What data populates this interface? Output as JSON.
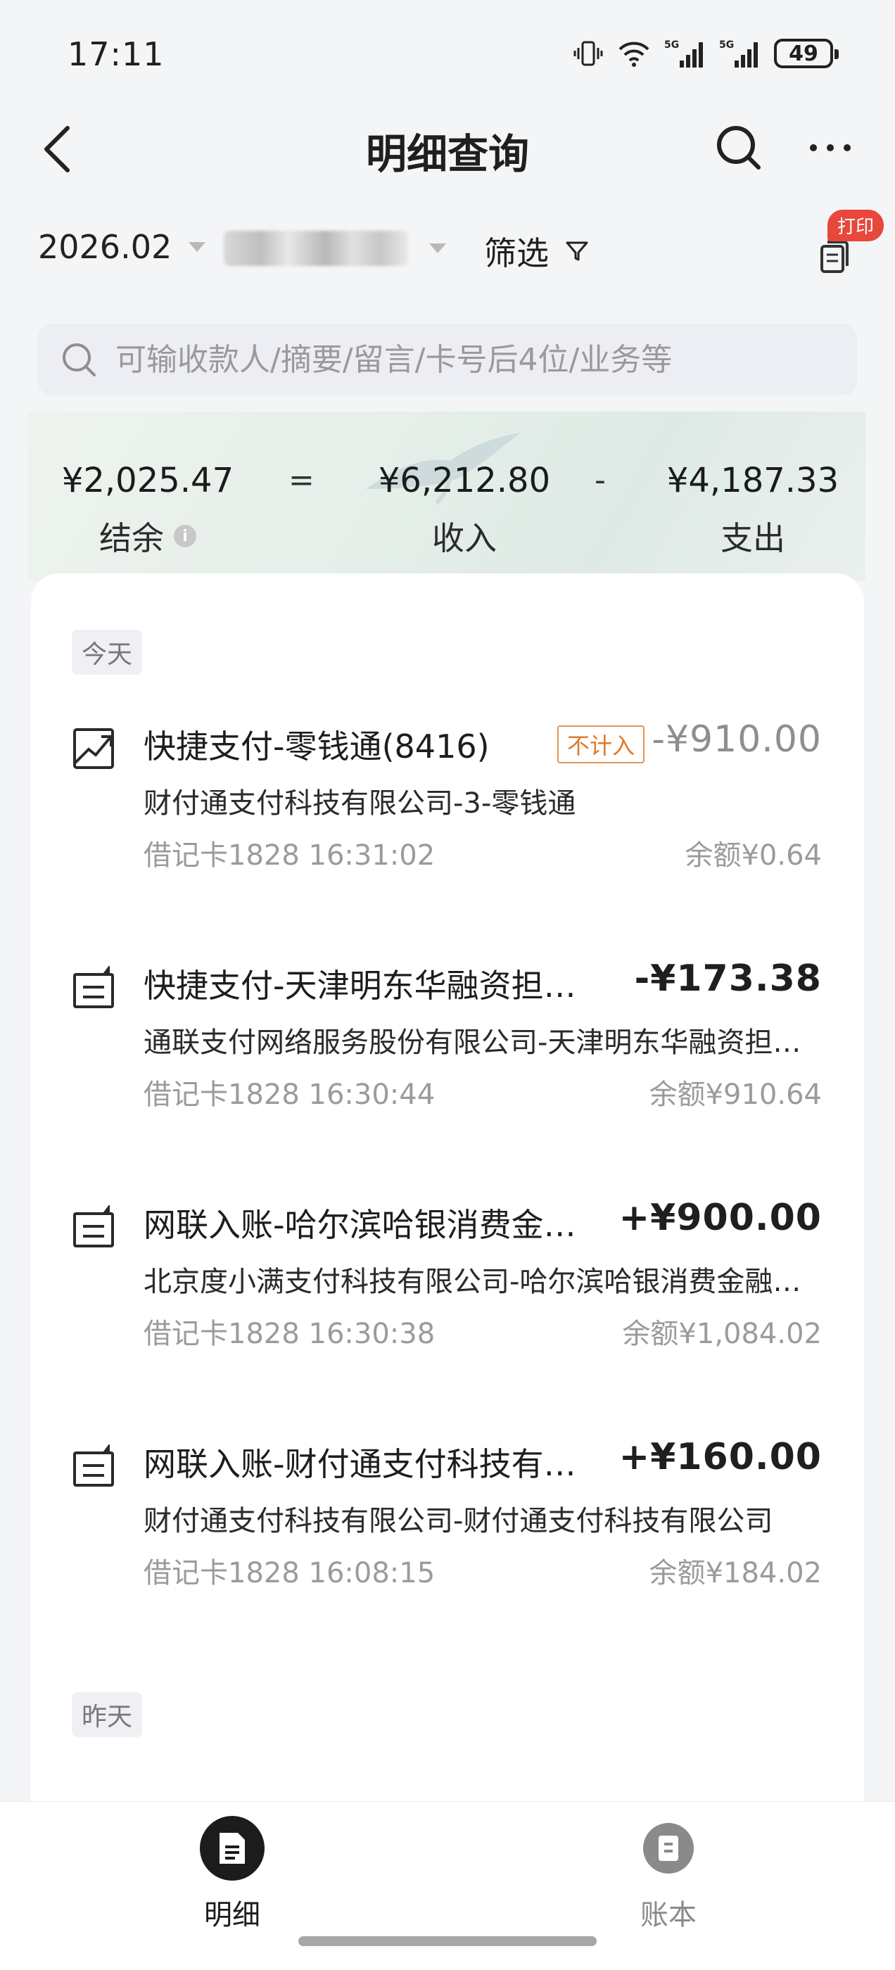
{
  "status": {
    "time": "17:11",
    "battery": "49"
  },
  "nav": {
    "title": "明细查询"
  },
  "filters": {
    "date": "2026.02",
    "filter_label": "筛选",
    "print_badge": "打印"
  },
  "search": {
    "placeholder": "可输收款人/摘要/留言/卡号后4位/业务等"
  },
  "summary": {
    "balance": "¥2,025.47",
    "balance_label": "结余",
    "equals": "=",
    "income": "¥6,212.80",
    "income_label": "收入",
    "minus": "-",
    "expense": "¥4,187.33",
    "expense_label": "支出"
  },
  "groups": [
    {
      "label": "今天",
      "transactions": [
        {
          "title": "快捷支付-零钱通(8416)",
          "tag": "不计入",
          "amount": "-¥910.00",
          "counterparty": "财付通支付科技有限公司-3-零钱通",
          "meta": "借记卡1828 16:31:02",
          "balance": "余额¥0.64",
          "icon": "trend-icon"
        },
        {
          "title": "快捷支付-天津明东华融资担…",
          "amount": "-¥173.38",
          "counterparty": "通联支付网络服务股份有限公司-天津明东华融资担…",
          "meta": "借记卡1828 16:30:44",
          "balance": "余额¥910.64",
          "icon": "receipt-icon"
        },
        {
          "title": "网联入账-哈尔滨哈银消费金…",
          "amount": "+¥900.00",
          "counterparty": "北京度小满支付科技有限公司-哈尔滨哈银消费金融…",
          "meta": "借记卡1828 16:30:38",
          "balance": "余额¥1,084.02",
          "icon": "receipt-icon"
        },
        {
          "title": "网联入账-财付通支付科技有…",
          "amount": "+¥160.00",
          "counterparty": "财付通支付科技有限公司-财付通支付科技有限公司",
          "meta": "借记卡1828 16:08:15",
          "balance": "余额¥184.02",
          "icon": "receipt-icon"
        }
      ]
    },
    {
      "label": "昨天",
      "transactions": []
    }
  ],
  "tabs": [
    {
      "label": "明细",
      "active": true,
      "icon": "document-icon"
    },
    {
      "label": "账本",
      "active": false,
      "icon": "ledger-icon"
    }
  ],
  "colors": {
    "accent_orange": "#e07a2c",
    "badge_red": "#e8473c",
    "text_dark": "#1d1d1d",
    "text_gray": "#9b9b9b"
  }
}
